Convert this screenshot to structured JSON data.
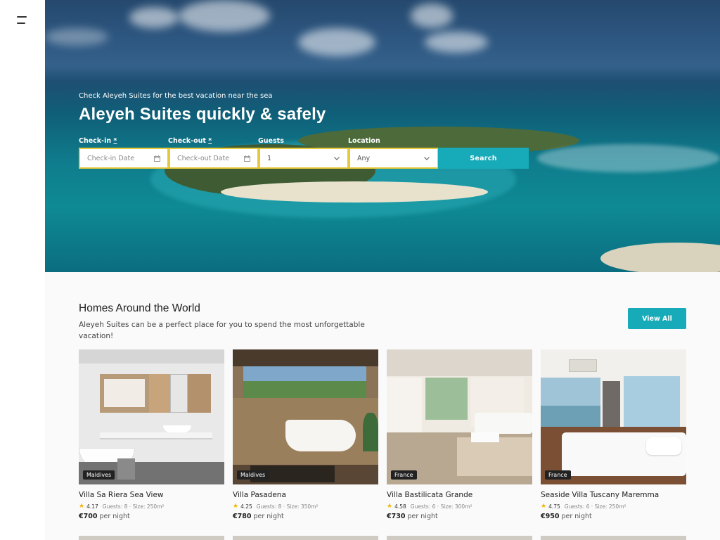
{
  "nav": {
    "menu_icon": "hamburger-icon"
  },
  "hero": {
    "subtitle": "Check Aleyeh Suites for the best vacation near the sea",
    "title": "Aleyeh Suites quickly & safely",
    "fields": {
      "checkin": {
        "label": "Check-in",
        "required_mark": "*",
        "placeholder": "Check-in Date",
        "icon": "calendar-icon"
      },
      "checkout": {
        "label": "Check-out",
        "required_mark": "*",
        "placeholder": "Check-out Date",
        "icon": "calendar-icon"
      },
      "guests": {
        "label": "Guests",
        "value": "1",
        "icon": "chevron-down-icon"
      },
      "location": {
        "label": "Location",
        "value": "Any",
        "icon": "chevron-down-icon"
      }
    },
    "search_label": "Search",
    "colors": {
      "accent": "#17aab8",
      "field_border": "#e6c93a"
    }
  },
  "homes": {
    "title": "Homes Around the World",
    "description": "Aleyeh Suites can be a perfect place for you to spend the most unforgettable vacation!",
    "view_all_label": "View All",
    "cards": [
      {
        "location": "Maldives",
        "name": "Villa Sa Riera Sea View",
        "rating": "4.17",
        "guests": "Guests: 8",
        "size": "Size: 250m²",
        "price": "€700",
        "price_unit": "per night"
      },
      {
        "location": "Maldives",
        "name": "Villa Pasadena",
        "rating": "4.25",
        "guests": "Guests: 8",
        "size": "Size: 350m²",
        "price": "€780",
        "price_unit": "per night"
      },
      {
        "location": "France",
        "name": "Villa Bastilicata Grande",
        "rating": "4.58",
        "guests": "Guests: 6",
        "size": "Size: 300m²",
        "price": "€730",
        "price_unit": "per night"
      },
      {
        "location": "France",
        "name": "Seaside Villa Tuscany Maremma",
        "rating": "4.75",
        "guests": "Guests: 6",
        "size": "Size: 250m²",
        "price": "€950",
        "price_unit": "per night"
      }
    ],
    "separator": "·"
  }
}
